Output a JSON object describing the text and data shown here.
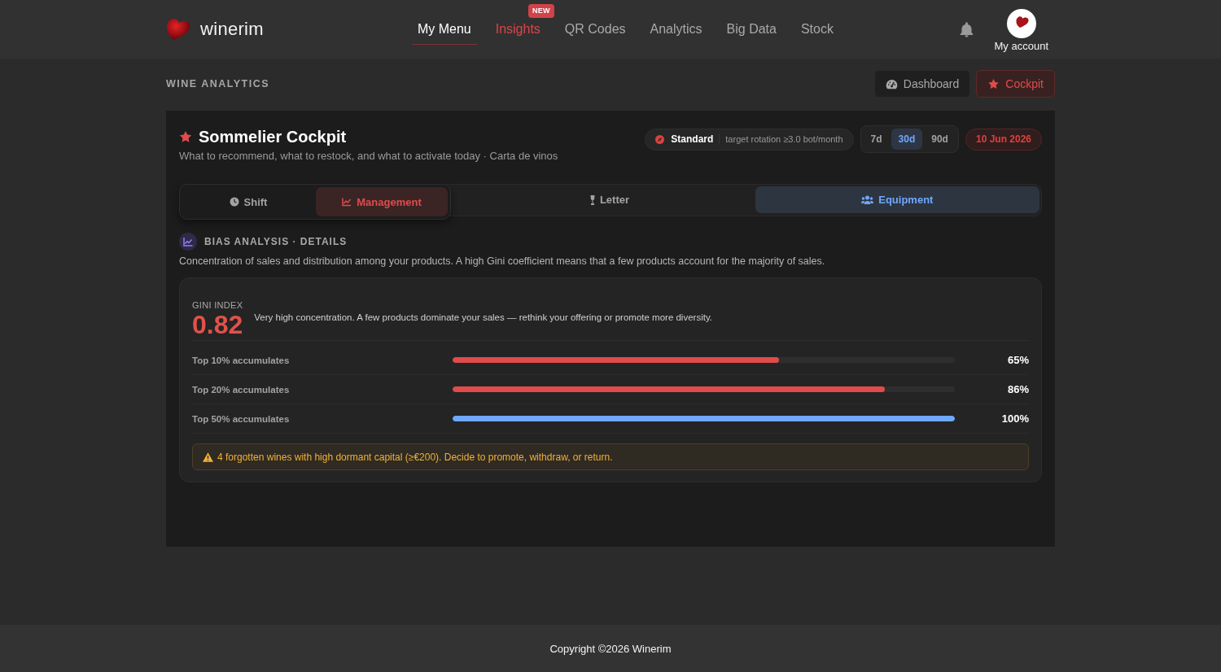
{
  "header": {
    "brand": "winerim",
    "nav": [
      {
        "label": "My Menu",
        "selected": true,
        "highlighted": false
      },
      {
        "label": "Insights",
        "selected": false,
        "highlighted": true,
        "badge": "NEW"
      },
      {
        "label": "QR Codes",
        "selected": false,
        "highlighted": false
      },
      {
        "label": "Analytics",
        "selected": false,
        "highlighted": false
      },
      {
        "label": "Big Data",
        "selected": false,
        "highlighted": false
      },
      {
        "label": "Stock",
        "selected": false,
        "highlighted": false
      }
    ],
    "account": "My account"
  },
  "page": {
    "section_label": "WINE ANALYTICS",
    "views": [
      {
        "label": "Dashboard",
        "selected": false
      },
      {
        "label": "Cockpit",
        "selected": true
      }
    ]
  },
  "cockpit": {
    "title": "Sommelier Cockpit",
    "subtitle": "What to recommend, what to restock, and what to activate today · Carta de vinos",
    "plan": {
      "name": "Standard",
      "detail": "target rotation ≥3.0 bot/month"
    },
    "periods": [
      {
        "label": "7d",
        "selected": false
      },
      {
        "label": "30d",
        "selected": true
      },
      {
        "label": "90d",
        "selected": false
      }
    ],
    "date": "10 Jun 2026",
    "tab_groups": [
      {
        "color": "#e04b4b",
        "tabs": [
          {
            "label": "Shift",
            "selected": false
          },
          {
            "label": "Management",
            "selected": true
          }
        ]
      },
      {
        "color": "#6ea8fe",
        "tabs": [
          {
            "label": "Letter",
            "selected": false
          },
          {
            "label": "Equipment",
            "selected": true
          }
        ]
      }
    ]
  },
  "analysis": {
    "title": "BIAS ANALYSIS · DETAILS",
    "description": "Concentration of sales and distribution among your products. A high Gini coefficient means that a few products account for the majority of sales.",
    "gini": {
      "label": "GINI INDEX",
      "value": "0.82",
      "comment": "Very high concentration. A few products dominate your sales — rethink your offering or promote more diversity."
    },
    "rows": [
      {
        "label": "Top 10% accumulates",
        "level": 0.65,
        "value": "65%",
        "color": "#e04b4b"
      },
      {
        "label": "Top 20% accumulates",
        "level": 0.86,
        "value": "86%",
        "color": "#e04b4b"
      },
      {
        "label": "Top 50% accumulates",
        "level": 1,
        "value": "100%",
        "color": "#6ea8fe"
      }
    ],
    "alert": "4 forgotten wines with high dormant capital (≥€200). Decide to promote, withdraw, or return."
  },
  "footer": {
    "copyright": "Copyright ©2026 Winerim"
  }
}
